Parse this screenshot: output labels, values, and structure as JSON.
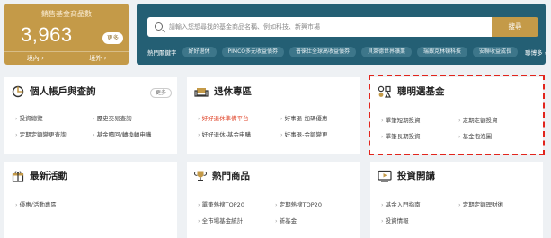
{
  "fund_card": {
    "label": "銷售基金商品數",
    "count": "3,963",
    "more_label": "更多",
    "domestic_label": "境內",
    "foreign_label": "境外"
  },
  "search": {
    "placeholder": "請輸入您想尋找的基金商品名稱、例如科技、新興市場",
    "button_label": "搜尋",
    "hot_label": "熱門關鍵字",
    "tags": [
      "好好退休",
      "PIMCO多元收益債券",
      "普徠仕全球高收益債券",
      "貝萊德世界礦業",
      "瑞銀克林頓科技",
      "安聯收益成長"
    ],
    "more_label": "聯博多"
  },
  "cards": {
    "account": {
      "title": "個人帳戶與查詢",
      "more_label": "更多",
      "links": [
        "投資總覽",
        "歷史交易查詢",
        "定期定額變更查詢",
        "基金贖回/轉換轉申購"
      ]
    },
    "retire": {
      "title": "退休專區",
      "links": [
        "好好退休準備平台",
        "好事退-加碼優惠",
        "好好退休-基金申購",
        "好事退-金額變更"
      ]
    },
    "smart": {
      "title": "聰明選基金",
      "links": [
        "單筆短期投資",
        "定期定額投資",
        "單筆長期投資",
        "基金泡泡圖"
      ]
    },
    "events": {
      "title": "最新活動",
      "links": [
        "優惠/活動專區"
      ]
    },
    "popular": {
      "title": "熱門商品",
      "links": [
        "單筆熱搜TOP20",
        "定期熱搜TOP20",
        "全市場基金統計",
        "新基金"
      ]
    },
    "learn": {
      "title": "投資開講",
      "links": [
        "基金入門指南",
        "定期定額理財術",
        "投資情報"
      ]
    }
  },
  "colors": {
    "gold": "#c49a48",
    "teal": "#245f74",
    "highlight_red": "#e0452a",
    "dash_red": "#e2251d"
  },
  "icons": {
    "account": "chart-pie-icon",
    "retire": "armchair-icon",
    "smart": "shapes-icon",
    "events": "gift-icon",
    "popular": "trophy-icon",
    "learn": "video-play-icon"
  }
}
